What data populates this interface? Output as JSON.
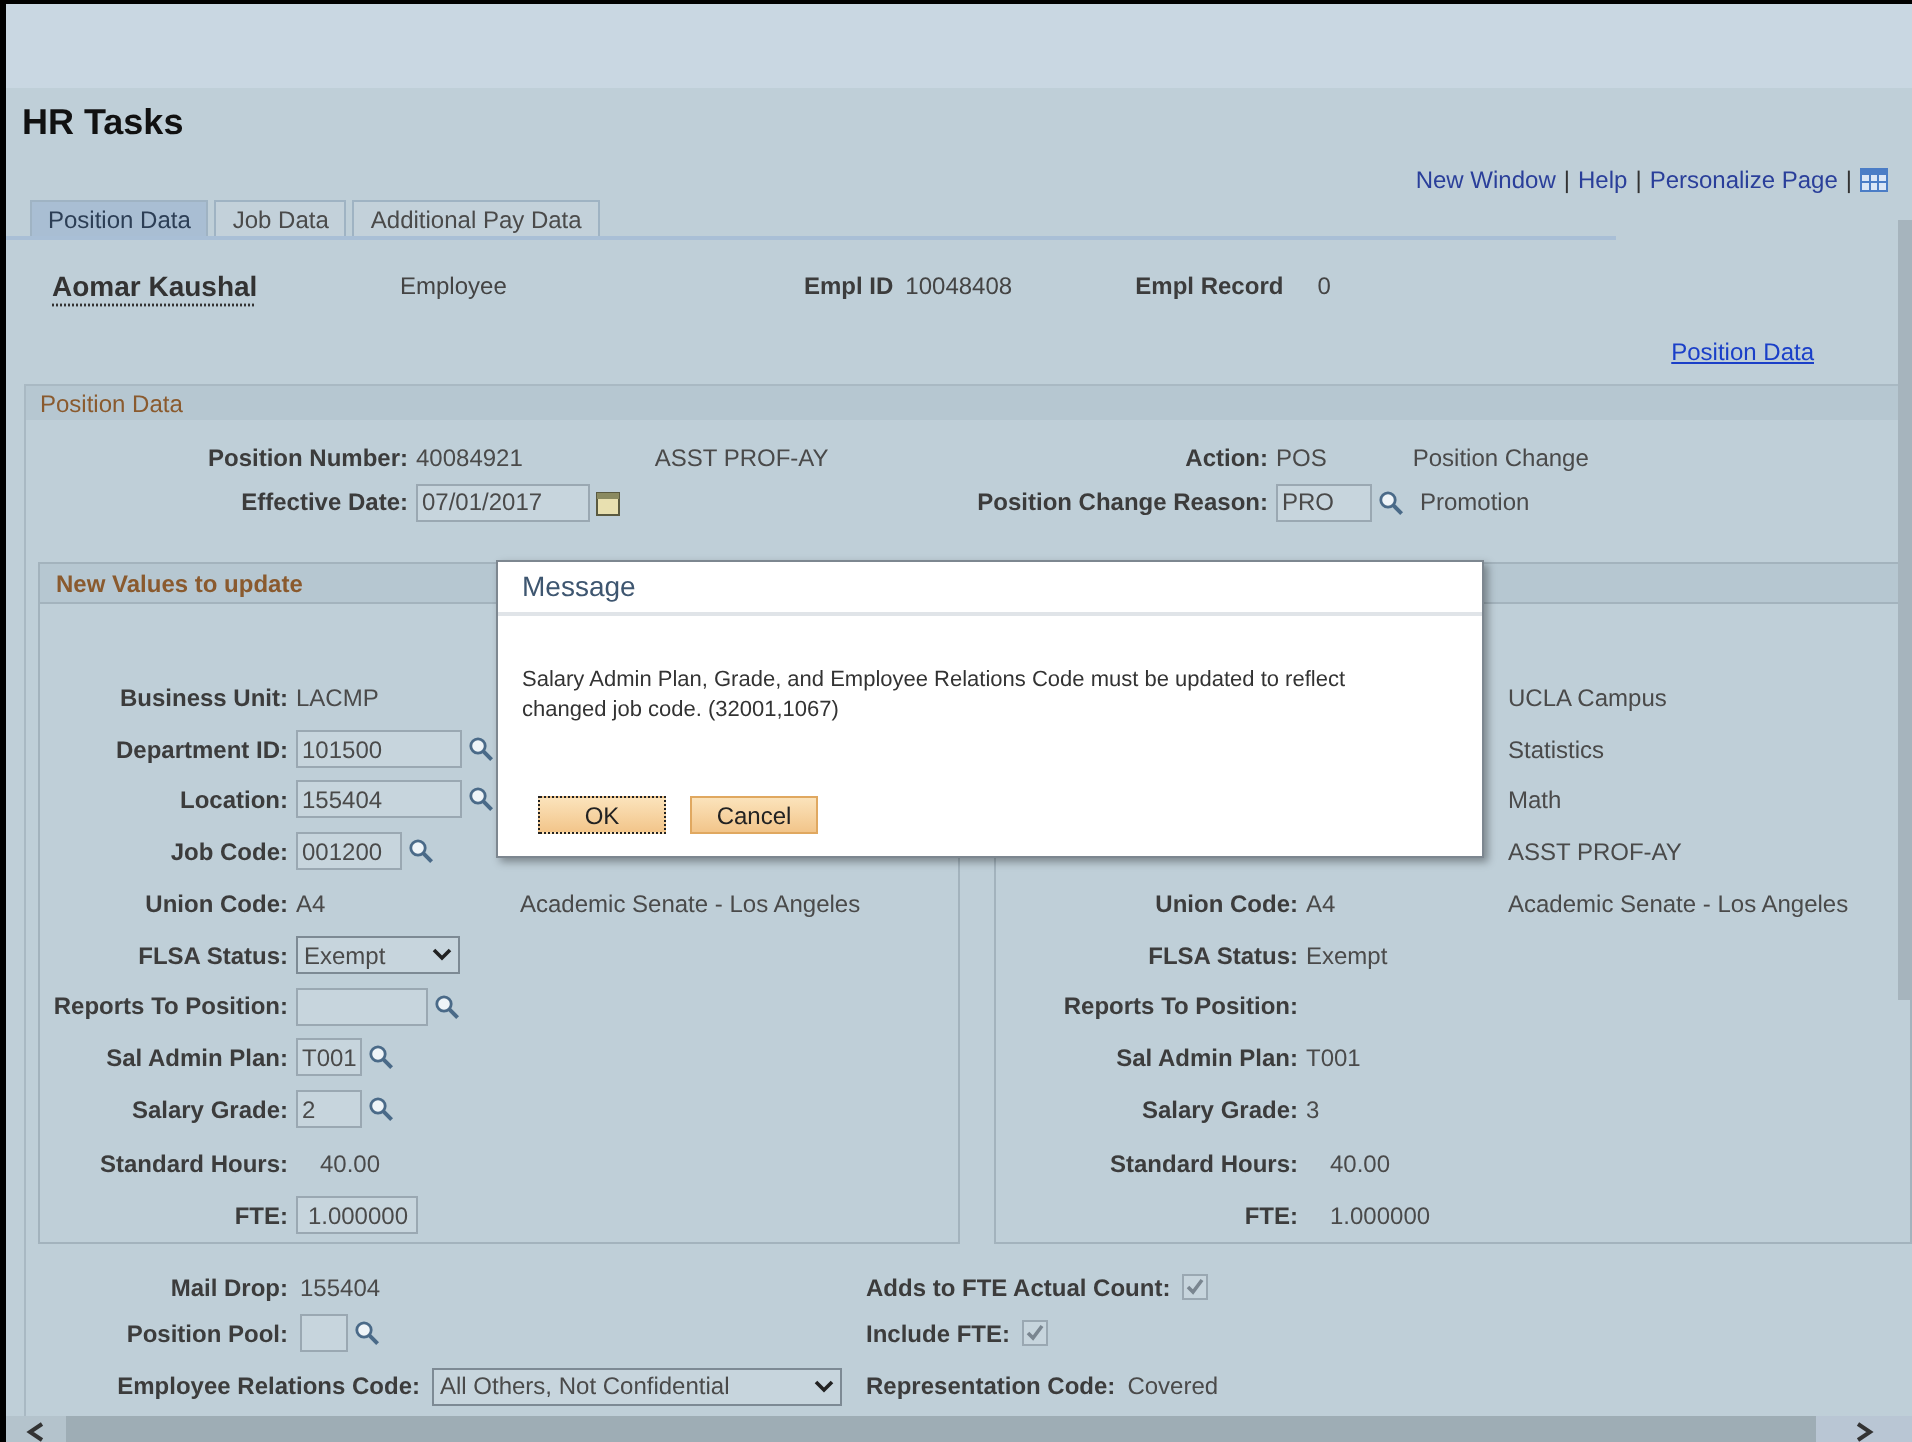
{
  "header": {
    "title": "HR Tasks"
  },
  "links": [
    "New Window",
    "Help",
    "Personalize Page"
  ],
  "link_separator": "|",
  "tabs": [
    {
      "label": "Position Data",
      "selected": true
    },
    {
      "label": "Job Data",
      "selected": false
    },
    {
      "label": "Additional Pay Data",
      "selected": false
    }
  ],
  "employee": {
    "name": "Aomar Kaushal",
    "type": "Employee",
    "empl_id_label": "Empl ID",
    "empl_id": "10048408",
    "empl_record_label": "Empl Record",
    "empl_record": "0"
  },
  "page_link": "Position Data",
  "section": {
    "title": "Position Data",
    "rows": [
      [
        {
          "label": "Position Number:",
          "kind": "text",
          "value": "40084921",
          "description": "ASST PROF-AY"
        },
        {
          "label": "Action:",
          "kind": "text",
          "value": "POS",
          "description": "Position Change"
        }
      ],
      [
        {
          "label": "Effective Date:",
          "kind": "date",
          "value": "07/01/2017"
        },
        {
          "label": "Position Change Reason:",
          "kind": "lookup",
          "value": "PRO",
          "description": "Promotion"
        }
      ]
    ]
  },
  "left_panel": {
    "title": "New Values to update",
    "rows": [
      {
        "label": "Business Unit:",
        "kind": "text",
        "value": "LACMP"
      },
      {
        "label": "Department ID:",
        "kind": "lookup",
        "value": "101500"
      },
      {
        "label": "Location:",
        "kind": "lookup",
        "value": "155404"
      },
      {
        "label": "Job Code:",
        "kind": "lookup",
        "value": "001200"
      },
      {
        "label": "Union Code:",
        "kind": "text",
        "value": "A4",
        "description": "Academic Senate - Los Angeles"
      },
      {
        "label": "FLSA Status:",
        "kind": "select",
        "value": "Exempt"
      },
      {
        "label": "Reports To Position:",
        "kind": "lookup"
      },
      {
        "label": "Sal Admin Plan:",
        "kind": "lookup",
        "value": "T001"
      },
      {
        "label": "Salary Grade:",
        "kind": "lookup",
        "value": "2"
      },
      {
        "label": "Standard Hours:",
        "kind": "text",
        "value": "40.00"
      },
      {
        "label": "FTE:",
        "kind": "input",
        "value": "1.000000"
      }
    ]
  },
  "right_panel": {
    "rows": [
      {
        "kind": "text",
        "description": "UCLA Campus"
      },
      {
        "kind": "text",
        "description": "Statistics"
      },
      {
        "kind": "text",
        "description": "Math"
      },
      {
        "kind": "text",
        "description": "ASST PROF-AY"
      },
      {
        "label": "Union Code:",
        "kind": "text",
        "value": "A4",
        "description": "Academic Senate - Los Angeles"
      },
      {
        "label": "FLSA Status:",
        "kind": "text",
        "value": "Exempt"
      },
      {
        "label": "Reports To Position:",
        "kind": "text"
      },
      {
        "label": "Sal Admin Plan:",
        "kind": "text",
        "value": "T001"
      },
      {
        "label": "Salary Grade:",
        "kind": "text",
        "value": "3"
      },
      {
        "label": "Standard Hours:",
        "kind": "text",
        "value": "40.00"
      },
      {
        "label": "FTE:",
        "kind": "text",
        "value": "1.000000"
      }
    ]
  },
  "bottom_left": [
    {
      "label": "Mail Drop:",
      "kind": "text",
      "value": "155404"
    },
    {
      "label": "Position Pool:",
      "kind": "lookup"
    },
    {
      "label": "Employee Relations Code:",
      "kind": "select",
      "value": "All Others, Not Confidential"
    }
  ],
  "bottom_right": [
    {
      "label": "Adds to FTE Actual Count:",
      "kind": "checkbox",
      "checked": true
    },
    {
      "label": "Include FTE:",
      "kind": "checkbox",
      "checked": true
    },
    {
      "label": "Representation Code:",
      "kind": "text",
      "value": "Covered"
    }
  ],
  "dialog": {
    "title": "Message",
    "text": "Salary Admin Plan, Grade, and Employee Relations Code must be updated to reflect changed job code. (32001,1067)",
    "buttons": [
      {
        "label": "OK",
        "focused": true
      },
      {
        "label": "Cancel",
        "focused": false
      }
    ]
  }
}
